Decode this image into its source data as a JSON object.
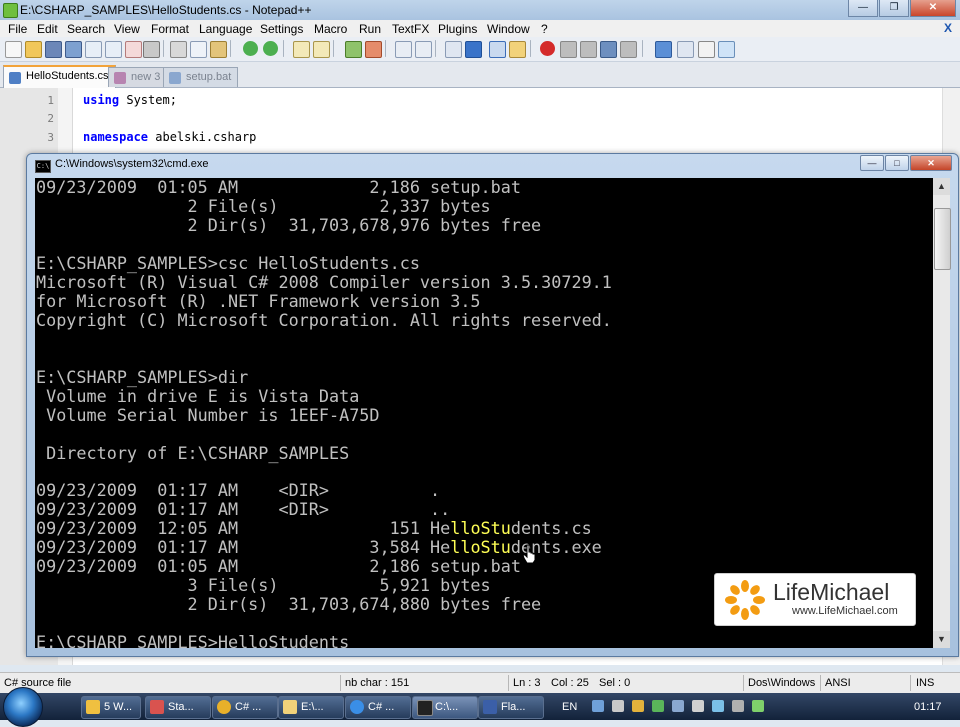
{
  "notepad": {
    "title": "E:\\CSHARP_SAMPLES\\HelloStudents.cs - Notepad++",
    "menu": [
      "File",
      "Edit",
      "Search",
      "View",
      "Format",
      "Language",
      "Settings",
      "Macro",
      "Run",
      "TextFX",
      "Plugins",
      "Window",
      "?"
    ],
    "menu_close": "X",
    "tabs": [
      {
        "label": "HelloStudents.cs",
        "active": true
      },
      {
        "label": "new 3",
        "active": false
      },
      {
        "label": "setup.bat",
        "active": false
      }
    ],
    "lines": [
      {
        "num": "1",
        "kw": "using",
        "rest": " System;"
      },
      {
        "num": "2",
        "kw": "",
        "rest": ""
      },
      {
        "num": "3",
        "kw": "namespace",
        "rest": " abelski.csharp"
      }
    ],
    "status": {
      "file_type": "C# source file",
      "length": "nb char : 151",
      "ln": "Ln : 3",
      "col": "Col : 25",
      "sel": "Sel : 0",
      "eol": "Dos\\Windows",
      "encoding": "ANSI",
      "mode": "INS"
    }
  },
  "cmd": {
    "title": "C:\\Windows\\system32\\cmd.exe",
    "icon_text": "C:\\",
    "lines": [
      "09/23/2009  01:05 AM             2,186 setup.bat",
      "               2 File(s)          2,337 bytes",
      "               2 Dir(s)  31,703,678,976 bytes free",
      "",
      "E:\\CSHARP_SAMPLES>csc HelloStudents.cs",
      "Microsoft (R) Visual C# 2008 Compiler version 3.5.30729.1",
      "for Microsoft (R) .NET Framework version 3.5",
      "Copyright (C) Microsoft Corporation. All rights reserved.",
      "",
      "",
      "E:\\CSHARP_SAMPLES>dir",
      " Volume in drive E is Vista Data",
      " Volume Serial Number is 1EEF-A75D",
      "",
      " Directory of E:\\CSHARP_SAMPLES",
      "",
      "09/23/2009  01:17 AM    <DIR>          .",
      "09/23/2009  01:17 AM    <DIR>          ..",
      "09/23/2009  12:05 AM               151 HelloStudents.cs",
      "09/23/2009  01:17 AM             3,584 HelloStudents.exe",
      "09/23/2009  01:05 AM             2,186 setup.bat",
      "               3 File(s)          5,921 bytes",
      "               2 Dir(s)  31,703,674,880 bytes free",
      "",
      "E:\\CSHARP_SAMPLES>HelloStudents"
    ]
  },
  "logo": {
    "brand": "LifeMichael",
    "url": "www.LifeMichael.com"
  },
  "taskbar": {
    "items": [
      {
        "label": "5 W...",
        "color": "#f0c040"
      },
      {
        "label": "Sta...",
        "color": "#d9534f"
      },
      {
        "label": "C# ...",
        "color": "#e8b02a"
      },
      {
        "label": "E:\\...",
        "color": "#f2d27a"
      },
      {
        "label": "C# ...",
        "color": "#3a8ee6"
      },
      {
        "label": "C:\\...",
        "color": "#222222"
      },
      {
        "label": "Fla...",
        "color": "#3b5fa8"
      }
    ],
    "lang": "EN",
    "time": "01:17"
  },
  "colors": {
    "console_bg": "#000000",
    "console_text": "#c0c0c0",
    "highlight": "#ffff55",
    "keyword": "#0000ff",
    "logo_orange": "#f39c12"
  }
}
